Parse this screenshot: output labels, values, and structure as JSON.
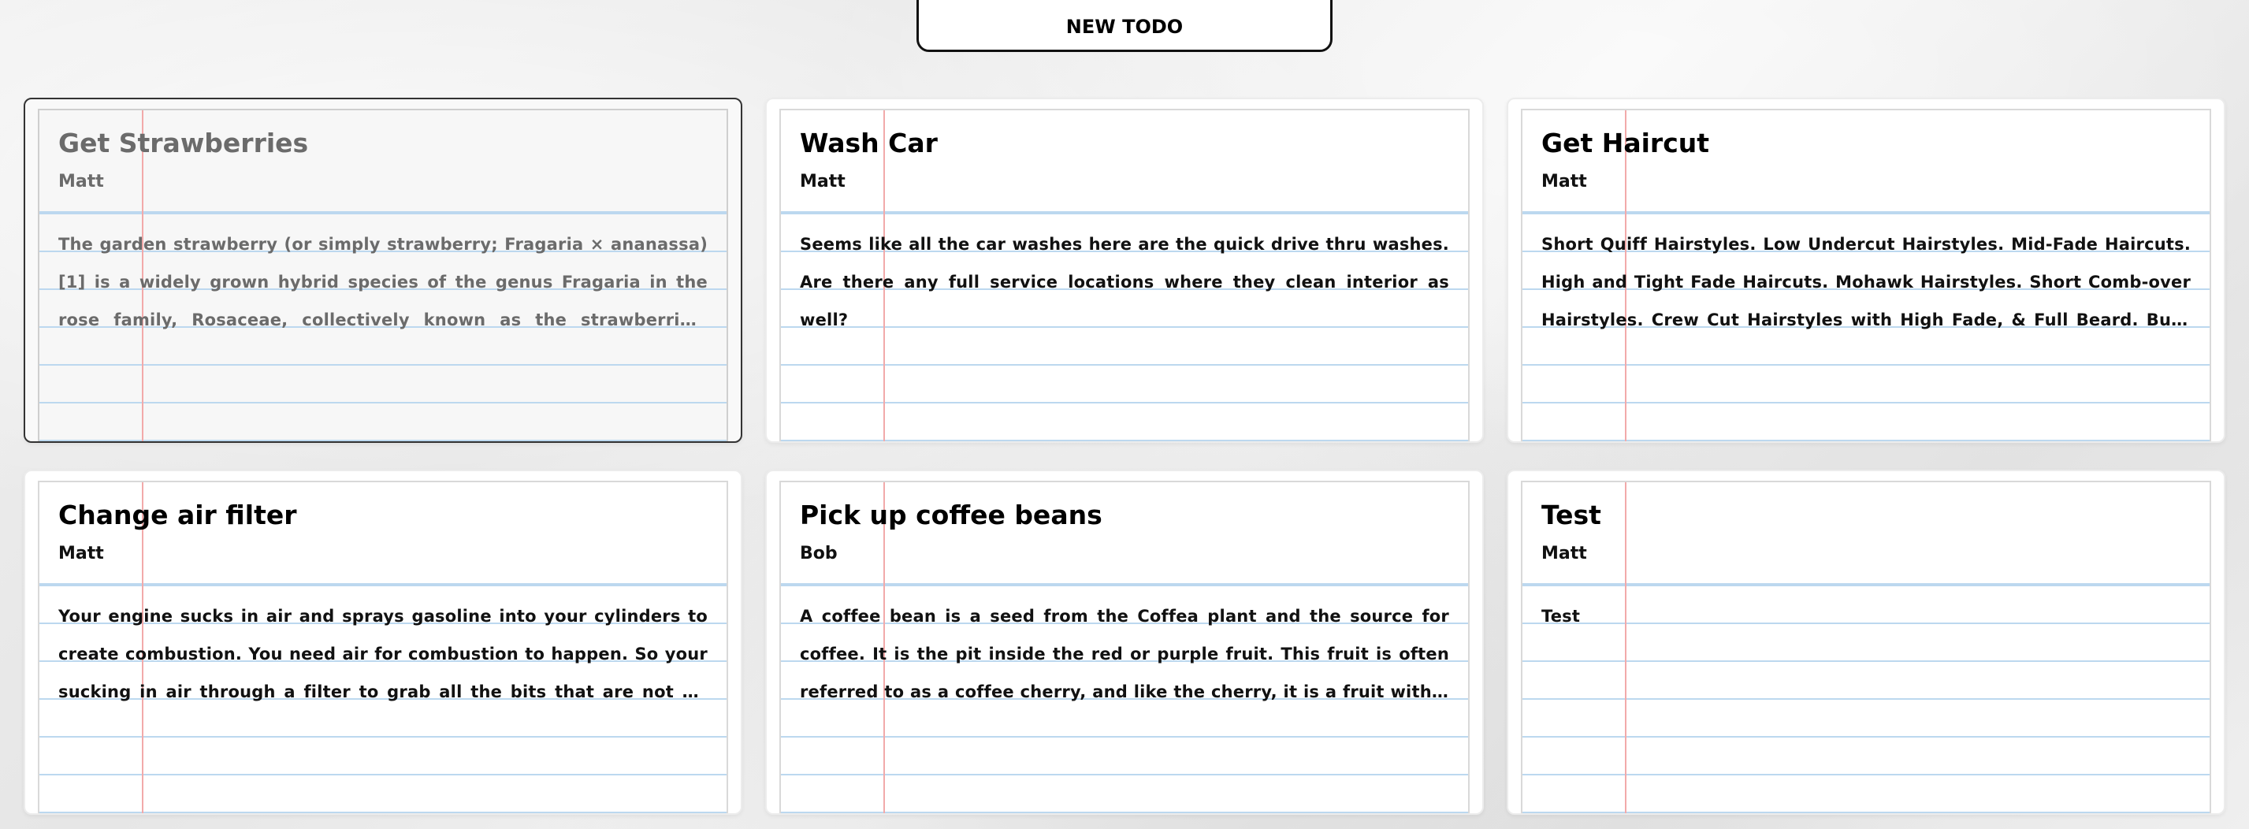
{
  "header": {
    "new_todo_label": "NEW TODO"
  },
  "todos": [
    {
      "title": "Get Strawberries",
      "author": "Matt",
      "description": "The garden strawberry (or simply strawberry; Fragaria × ananassa)[1] is a widely grown hybrid species of the genus Fragaria in the rose family, Rosaceae, collectively known as the strawberries, which are cultivated worldwide for their fruit.",
      "selected": true
    },
    {
      "title": "Wash Car",
      "author": "Matt",
      "description": "Seems like all the car washes here are the quick drive thru washes. Are there any full service locations where they clean interior as well?",
      "selected": false
    },
    {
      "title": "Get Haircut",
      "author": "Matt",
      "description": "Short Quiff Hairstyles. Low Undercut Hairstyles. Mid-Fade Haircuts. High and Tight Fade Haircuts. Mohawk Hairstyles. Short Comb-over Hairstyles. Crew Cut Hairstyles with High Fade, & Full Beard. Buzz Cut Hairstyles.",
      "selected": false
    },
    {
      "title": "Change air filter",
      "author": "Matt",
      "description": "Your engine sucks in air and sprays gasoline into your cylinders to create combustion. You need air for combustion to happen. So your sucking in air through a filter to grab all the bits that are not air and keep them out of your engine.",
      "selected": false
    },
    {
      "title": "Pick up coffee beans",
      "author": "Bob",
      "description": "A coffee bean is a seed from the Coffea plant and the source for coffee. It is the pit inside the red or purple fruit. This fruit is often referred to as a coffee cherry, and like the cherry, it is a fruit with a pit. Even though the coffee beans are not technically beans.",
      "selected": false
    },
    {
      "title": "Test",
      "author": "Matt",
      "description": "Test",
      "selected": false
    }
  ]
}
